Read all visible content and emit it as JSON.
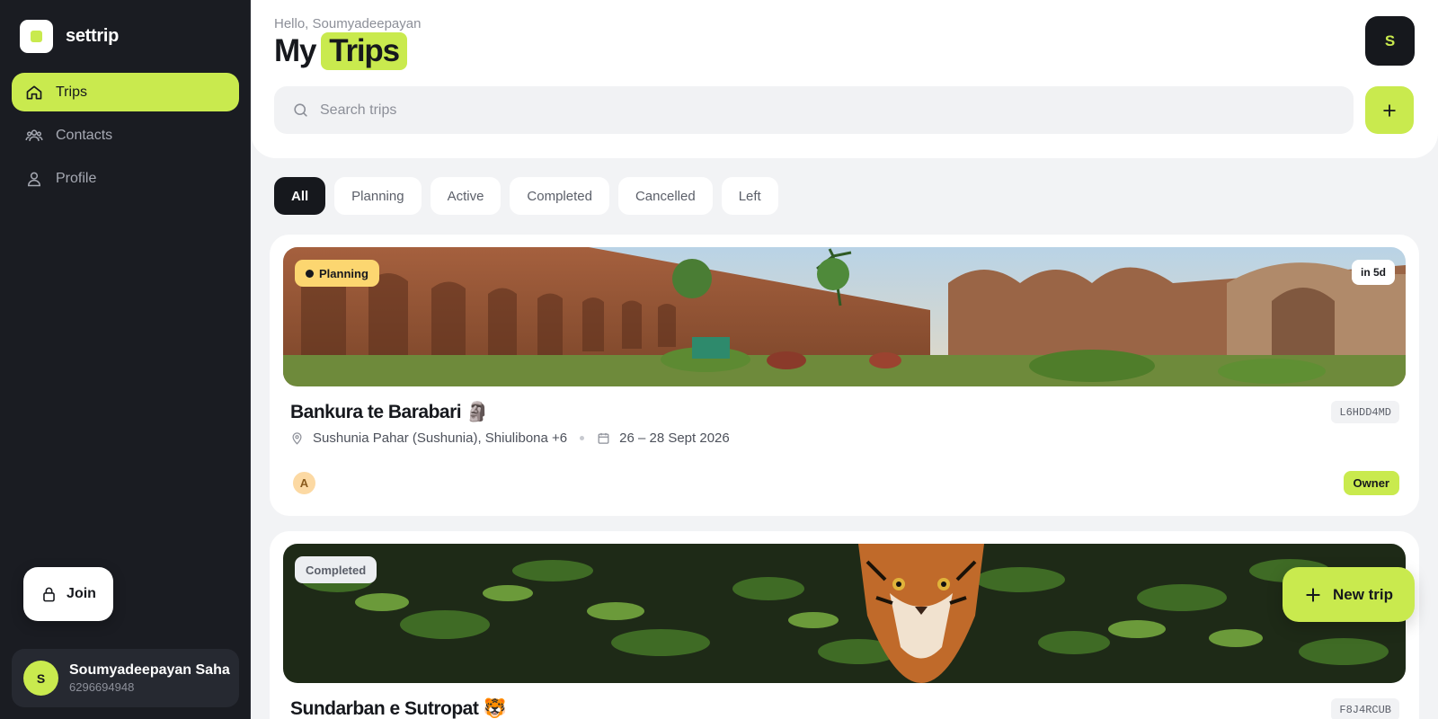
{
  "app": {
    "name": "settrip",
    "accent": "#c9ea4e"
  },
  "sidebar": {
    "items": [
      {
        "label": "Trips",
        "icon": "home-icon",
        "active": true
      },
      {
        "label": "Contacts",
        "icon": "users-icon"
      },
      {
        "label": "Profile",
        "icon": "user-icon"
      }
    ],
    "join_label": "Join",
    "user": {
      "initial": "S",
      "name": "Soumyadeepayan Saha",
      "phone": "6296694948"
    }
  },
  "header": {
    "greeting": "Hello, Soumyadeepayan",
    "title_prefix": "My",
    "title_highlight": "Trips",
    "avatar_initial": "S",
    "search_placeholder": "Search trips"
  },
  "filters": [
    "All",
    "Planning",
    "Active",
    "Completed",
    "Cancelled",
    "Left"
  ],
  "active_filter": "All",
  "trips": [
    {
      "status": "Planning",
      "countdown": "in 5d",
      "title": "Bankura te Barabari 🗿",
      "code": "L6HDD4MD",
      "places": "Sushunia Pahar (Sushunia), Shiulibona +6",
      "dates": "26 – 28 Sept 2026",
      "member_initial": "A",
      "role": "Owner"
    },
    {
      "status": "Completed",
      "title": "Sundarban e Sutropat 🐯",
      "code": "F8J4RCUB"
    }
  ],
  "fab_label": "New trip"
}
